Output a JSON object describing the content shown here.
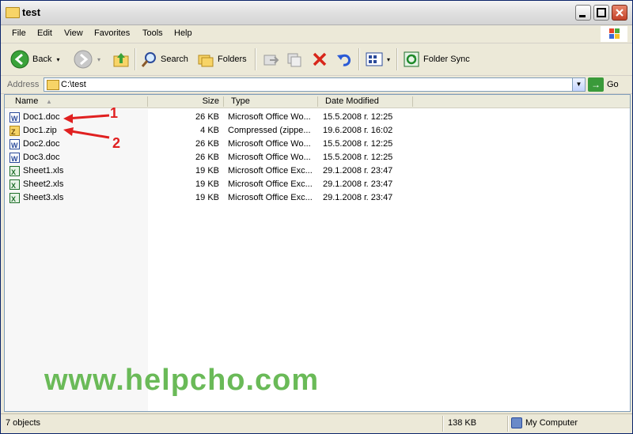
{
  "window": {
    "title": "test"
  },
  "menu": [
    "File",
    "Edit",
    "View",
    "Favorites",
    "Tools",
    "Help"
  ],
  "toolbar": {
    "back": "Back",
    "search": "Search",
    "folders": "Folders",
    "folder_sync": "Folder Sync"
  },
  "address": {
    "label": "Address",
    "path": "C:\\test",
    "go": "Go"
  },
  "columns": {
    "name": "Name",
    "size": "Size",
    "type": "Type",
    "date": "Date Modified"
  },
  "files": [
    {
      "name": "Doc1.doc",
      "size": "26 KB",
      "type": "Microsoft Office Wo...",
      "date": "15.5.2008 г. 12:25",
      "icon": "word-doc-icon"
    },
    {
      "name": "Doc1.zip",
      "size": "4 KB",
      "type": "Compressed (zippe...",
      "date": "19.6.2008 г. 16:02",
      "icon": "zip-icon"
    },
    {
      "name": "Doc2.doc",
      "size": "26 KB",
      "type": "Microsoft Office Wo...",
      "date": "15.5.2008 г. 12:25",
      "icon": "word-doc-icon"
    },
    {
      "name": "Doc3.doc",
      "size": "26 KB",
      "type": "Microsoft Office Wo...",
      "date": "15.5.2008 г. 12:25",
      "icon": "word-doc-icon"
    },
    {
      "name": "Sheet1.xls",
      "size": "19 KB",
      "type": "Microsoft Office Exc...",
      "date": "29.1.2008 г. 23:47",
      "icon": "excel-icon"
    },
    {
      "name": "Sheet2.xls",
      "size": "19 KB",
      "type": "Microsoft Office Exc...",
      "date": "29.1.2008 г. 23:47",
      "icon": "excel-icon"
    },
    {
      "name": "Sheet3.xls",
      "size": "19 KB",
      "type": "Microsoft Office Exc...",
      "date": "29.1.2008 г. 23:47",
      "icon": "excel-icon"
    }
  ],
  "annotations": {
    "arrow1": "1",
    "arrow2": "2"
  },
  "watermark": "www.helpcho.com",
  "status": {
    "objects": "7 objects",
    "size": "138 KB",
    "location": "My Computer"
  },
  "colors": {
    "accent_arrow": "#e02020",
    "watermark": "#6aba58"
  }
}
